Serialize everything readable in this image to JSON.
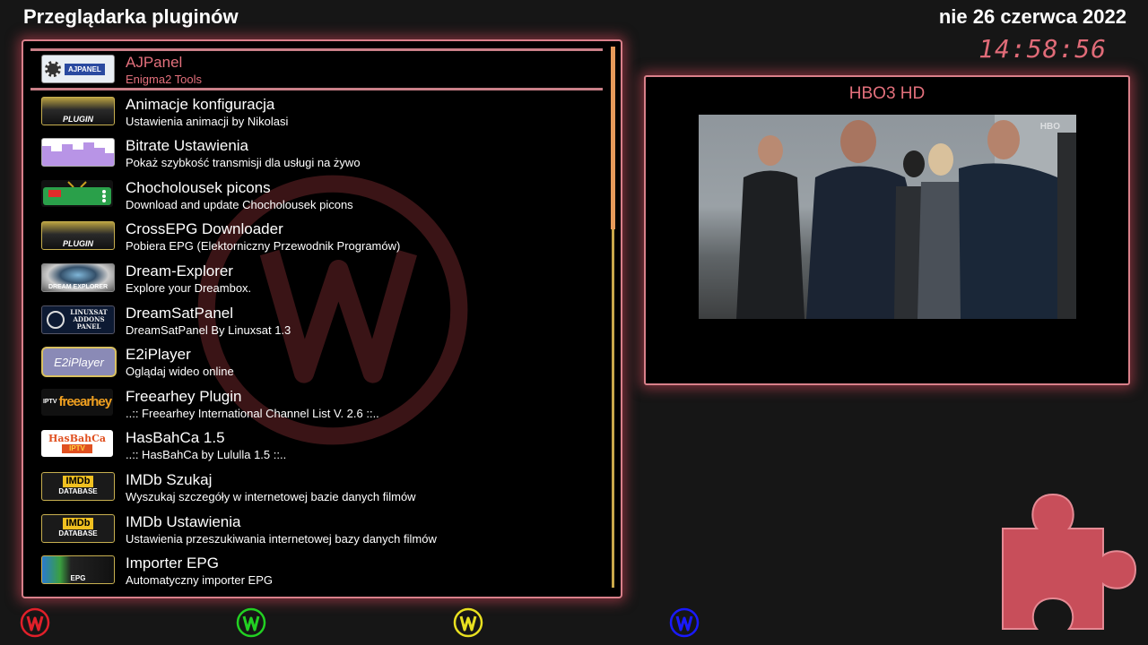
{
  "header": {
    "title": "Przeglądarka pluginów",
    "date": "nie 26 czerwca 2022",
    "time": "14:58:56"
  },
  "plugins": [
    {
      "name": "AJPanel",
      "description": "Enigma2 Tools",
      "icon": "ajpanel-icon",
      "selected": true
    },
    {
      "name": "Animacje konfiguracja",
      "description": "Ustawienia animacji by Nikolasi",
      "icon": "plugin-icon"
    },
    {
      "name": "Bitrate Ustawienia",
      "description": "Pokaż szybkość transmisji dla usługi na żywo",
      "icon": "bitrate-icon"
    },
    {
      "name": "Chocholousek picons",
      "description": "Download and update Chocholousek picons",
      "icon": "tv-icon"
    },
    {
      "name": "CrossEPG Downloader",
      "description": "Pobiera EPG (Elektorniczny Przewodnik Programów)",
      "icon": "plugin-icon"
    },
    {
      "name": "Dream-Explorer",
      "description": "Explore your Dreambox.",
      "icon": "dream-explorer-icon"
    },
    {
      "name": "DreamSatPanel",
      "description": "DreamSatPanel By Linuxsat 1.3",
      "icon": "linuxsat-icon"
    },
    {
      "name": "E2iPlayer",
      "description": "Oglądaj wideo online",
      "icon": "e2iplayer-icon"
    },
    {
      "name": "Freearhey Plugin",
      "description": "..:: Freearhey International Channel List V. 2.6 ::..",
      "icon": "freearhey-icon"
    },
    {
      "name": "HasBahCa  1.5",
      "description": "..:: HasBahCa by Lululla 1.5 ::..",
      "icon": "hasbahca-icon"
    },
    {
      "name": "IMDb Szukaj",
      "description": "Wyszukaj szczegóły w internetowej bazie danych filmów",
      "icon": "imdb-icon"
    },
    {
      "name": "IMDb Ustawienia",
      "description": "Ustawienia przeszukiwania internetowej bazy danych filmów",
      "icon": "imdb-icon"
    },
    {
      "name": "Importer EPG",
      "description": "Automatyczny importer EPG",
      "icon": "epg-icon"
    }
  ],
  "icon_text": {
    "ajpanel": "AJPANEL",
    "plugin": "PLUGIN",
    "dream_explorer": "DREAM EXPLORER",
    "linuxsat": "LINUXSAT ADDONS PANEL",
    "e2iplayer": "E2iPlayer",
    "freearhey_prefix": "IPTV",
    "freearhey": "freearhey",
    "hasbahca": "HasBahCa",
    "hasbahca_sub": "IPTV",
    "imdb": "IMDb",
    "imdb_sub": "DATABASE",
    "epg": "EPG"
  },
  "preview": {
    "channel": "HBO3 HD",
    "watermark": "HBO"
  },
  "colors": {
    "accent": "#e3707c",
    "border": "#d9808a",
    "red_button": "#e0202a",
    "green_button": "#22d022",
    "yellow_button": "#e8e020",
    "blue_button": "#1a1aff",
    "puzzle": "#c84e5a"
  }
}
